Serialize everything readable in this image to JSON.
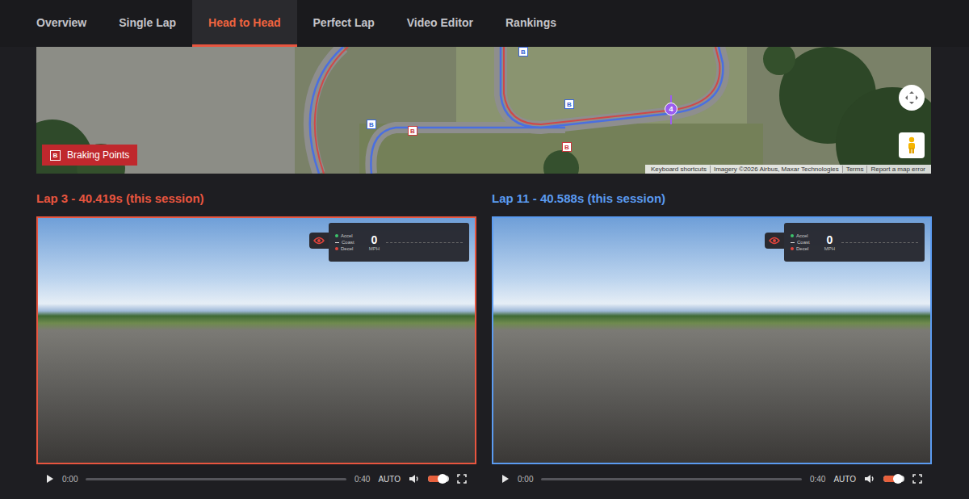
{
  "nav": {
    "tabs": [
      {
        "label": "Overview",
        "selected": false
      },
      {
        "label": "Single Lap",
        "selected": false
      },
      {
        "label": "Head to Head",
        "selected": true
      },
      {
        "label": "Perfect Lap",
        "selected": false
      },
      {
        "label": "Video Editor",
        "selected": false
      },
      {
        "label": "Rankings",
        "selected": false
      }
    ]
  },
  "map": {
    "legend": {
      "icon": "B",
      "label": "Braking Points"
    },
    "markers": [
      {
        "label": "B",
        "color": "#3a66d6"
      },
      {
        "label": "B",
        "color": "#3a66d6"
      },
      {
        "label": "B",
        "color": "#3a66d6"
      },
      {
        "label": "B",
        "color": "#c8383c"
      },
      {
        "label": "B",
        "color": "#c8383c"
      }
    ],
    "corner": {
      "label": "4",
      "color": "#9b5cf0"
    },
    "attribution": [
      "Keyboard shortcuts",
      "Imagery ©2026 Airbus, Maxar Technologies",
      "Terms",
      "Report a map error"
    ]
  },
  "laps": [
    {
      "title": "Lap 3 - 40.419s (this session)",
      "color": "#e8553f",
      "overlay": {
        "legend": [
          {
            "label": "Accel",
            "kind": "dot",
            "color": "#3cc36b"
          },
          {
            "label": "Coast",
            "kind": "dash",
            "color": "#d8d8d8"
          },
          {
            "label": "Decel",
            "kind": "dot",
            "color": "#e0443c"
          }
        ],
        "speed": "0",
        "unit": "MPH"
      },
      "player": {
        "current": "0:00",
        "duration": "0:40",
        "quality": "AUTO",
        "progress": 0,
        "volume": 0.7
      }
    },
    {
      "title": "Lap 11 - 40.588s (this session)",
      "color": "#5b9bf0",
      "overlay": {
        "legend": [
          {
            "label": "Accel",
            "kind": "dot",
            "color": "#3cc36b"
          },
          {
            "label": "Coast",
            "kind": "dash",
            "color": "#d8d8d8"
          },
          {
            "label": "Decel",
            "kind": "dot",
            "color": "#e0443c"
          }
        ],
        "speed": "0",
        "unit": "MPH"
      },
      "player": {
        "current": "0:00",
        "duration": "0:40",
        "quality": "AUTO",
        "progress": 0,
        "volume": 0.7
      }
    }
  ]
}
